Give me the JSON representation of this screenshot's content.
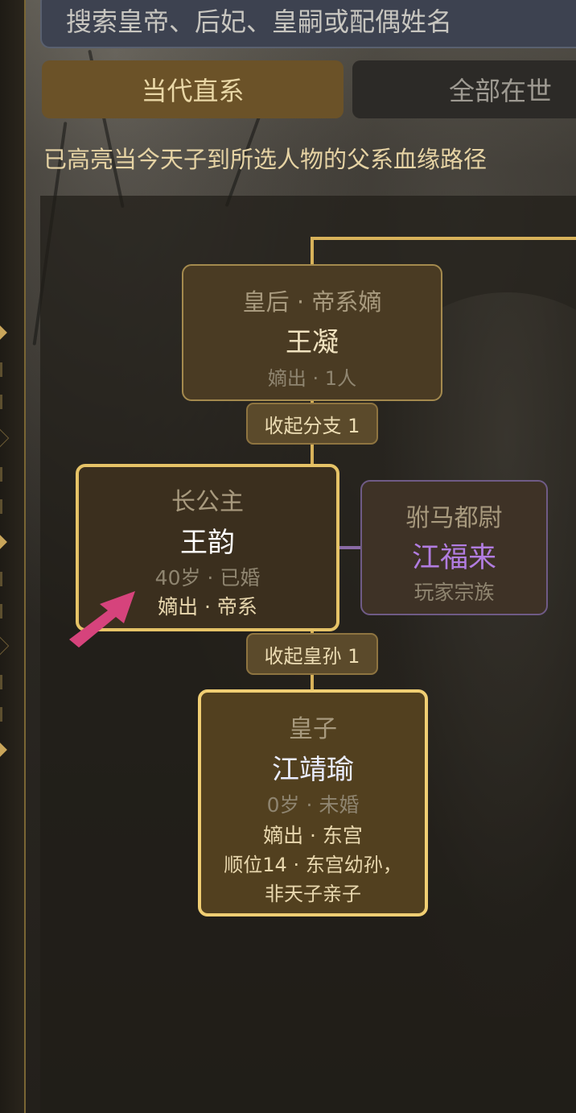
{
  "search": {
    "placeholder": "搜索皇帝、后妃、皇嗣或配偶姓名"
  },
  "tabs": [
    {
      "label": "当代直系",
      "active": true
    },
    {
      "label": "全部在世",
      "active": false
    }
  ],
  "hint": "已高亮当今天子到所选人物的父系血缘路径",
  "tree": {
    "empress": {
      "title": "皇后 · 帝系嫡",
      "name": "王凝",
      "sub": "嫡出 · 1人"
    },
    "collapse_branch": "收起分支 1",
    "princess": {
      "title": "长公主",
      "name": "王韵",
      "age_status": "40岁 · 已婚",
      "lineage": "嫡出 · 帝系"
    },
    "consort": {
      "title": "驸马都尉",
      "name": "江福来",
      "sub": "玩家宗族"
    },
    "collapse_grandchildren": "收起皇孙 1",
    "prince": {
      "title": "皇子",
      "name": "江靖瑜",
      "age_status": "0岁 · 未婚",
      "lineage": "嫡出 · 东宫",
      "note_line1": "顺位14 · 东宫幼孙，",
      "note_line2": "非天子亲子"
    }
  },
  "colors": {
    "accent_gold": "#e6c367",
    "consort_purple": "#b17ce0",
    "highlight_arrow": "#d6437c"
  },
  "icons": {
    "pointer": "pink-arrow-icon"
  }
}
